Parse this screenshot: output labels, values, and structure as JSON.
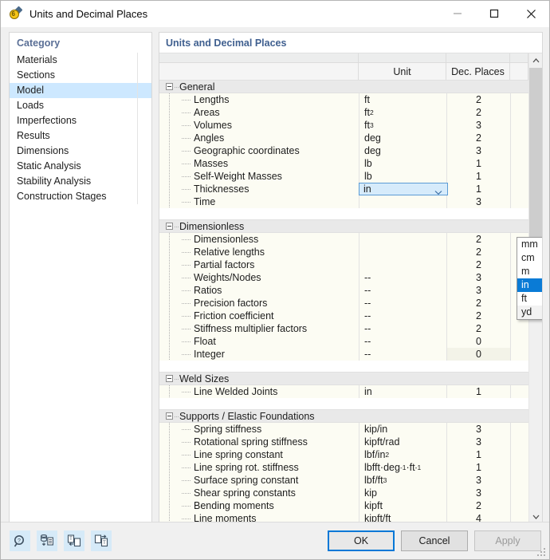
{
  "window": {
    "title": "Units and Decimal Places",
    "icon": "units-dialog-icon",
    "minimize_label": "Minimize",
    "maximize_label": "Maximize",
    "close_label": "Close"
  },
  "category": {
    "header": "Category",
    "items": [
      {
        "label": "Materials",
        "selected": false
      },
      {
        "label": "Sections",
        "selected": false
      },
      {
        "label": "Model",
        "selected": true
      },
      {
        "label": "Loads",
        "selected": false
      },
      {
        "label": "Imperfections",
        "selected": false
      },
      {
        "label": "Results",
        "selected": false
      },
      {
        "label": "Dimensions",
        "selected": false
      },
      {
        "label": "Static Analysis",
        "selected": false
      },
      {
        "label": "Stability Analysis",
        "selected": false
      },
      {
        "label": "Construction Stages",
        "selected": false
      }
    ]
  },
  "panel": {
    "title": "Units and Decimal Places",
    "columns": [
      "",
      "Unit",
      "Dec. Places",
      ""
    ],
    "groups": [
      {
        "name": "General",
        "rows": [
          {
            "label": "Lengths",
            "unit": "ft",
            "unit_sup": "",
            "dec": "2"
          },
          {
            "label": "Areas",
            "unit": "ft",
            "unit_sup": "2",
            "dec": "2"
          },
          {
            "label": "Volumes",
            "unit": "ft",
            "unit_sup": "3",
            "dec": "3"
          },
          {
            "label": "Angles",
            "unit": "deg",
            "unit_sup": "",
            "dec": "2"
          },
          {
            "label": "Geographic coordinates",
            "unit": "deg",
            "unit_sup": "",
            "dec": "3"
          },
          {
            "label": "Masses",
            "unit": "lb",
            "unit_sup": "",
            "dec": "1"
          },
          {
            "label": "Self-Weight Masses",
            "unit": "lb",
            "unit_sup": "",
            "dec": "1"
          },
          {
            "label": "Thicknesses",
            "unit": "in",
            "unit_sup": "",
            "dec": "1",
            "editing": true
          },
          {
            "label": "Time",
            "unit": "",
            "unit_sup": "",
            "dec": "3"
          }
        ]
      },
      {
        "name": "Dimensionless",
        "rows": [
          {
            "label": "Dimensionless",
            "unit": "",
            "unit_sup": "",
            "dec": "2"
          },
          {
            "label": "Relative lengths",
            "unit": "",
            "unit_sup": "",
            "dec": "2"
          },
          {
            "label": "Partial factors",
            "unit": "",
            "unit_sup": "",
            "dec": "2"
          },
          {
            "label": "Weights/Nodes",
            "unit": "--",
            "unit_sup": "",
            "dec": "3"
          },
          {
            "label": "Ratios",
            "unit": "--",
            "unit_sup": "",
            "dec": "3"
          },
          {
            "label": "Precision factors",
            "unit": "--",
            "unit_sup": "",
            "dec": "2"
          },
          {
            "label": "Friction coefficient",
            "unit": "--",
            "unit_sup": "",
            "dec": "2"
          },
          {
            "label": "Stiffness multiplier factors",
            "unit": "--",
            "unit_sup": "",
            "dec": "2"
          },
          {
            "label": "Float",
            "unit": "--",
            "unit_sup": "",
            "dec": "0"
          },
          {
            "label": "Integer",
            "unit": "--",
            "unit_sup": "",
            "dec": "0",
            "dec_highlight": true
          }
        ]
      },
      {
        "name": "Weld Sizes",
        "rows": [
          {
            "label": "Line Welded Joints",
            "unit": "in",
            "unit_sup": "",
            "dec": "1"
          }
        ]
      },
      {
        "name": "Supports / Elastic Foundations",
        "rows": [
          {
            "label": "Spring stiffness",
            "unit": "kip/in",
            "unit_sup": "",
            "dec": "3"
          },
          {
            "label": "Rotational spring stiffness",
            "unit": "kipft/rad",
            "unit_sup": "",
            "dec": "3"
          },
          {
            "label": "Line spring constant",
            "unit": "lbf/in",
            "unit_sup": "2",
            "dec": "1"
          },
          {
            "label": "Line spring rot. stiffness",
            "unit": "lbfft·deg",
            "unit_sup": "-1",
            "unit_tail": "·ft",
            "unit_tail_sup": "-1",
            "dec": "1"
          },
          {
            "label": "Surface spring constant",
            "unit": "lbf/ft",
            "unit_sup": "3",
            "dec": "3"
          },
          {
            "label": "Shear spring constants",
            "unit": "kip",
            "unit_sup": "",
            "dec": "3"
          },
          {
            "label": "Bending moments",
            "unit": "kipft",
            "unit_sup": "",
            "dec": "2"
          },
          {
            "label": "Line moments",
            "unit": "kipft/ft",
            "unit_sup": "",
            "dec": "4"
          }
        ]
      }
    ]
  },
  "dropdown": {
    "open": true,
    "options": [
      "mm",
      "cm",
      "m",
      "in",
      "ft",
      "yd"
    ],
    "selected": "in"
  },
  "footer": {
    "tools": [
      {
        "name": "find-icon",
        "label": "Find"
      },
      {
        "name": "import-database-icon",
        "label": "Import from database"
      },
      {
        "name": "import-units-icon",
        "label": "Import units"
      },
      {
        "name": "export-units-icon",
        "label": "Export units"
      }
    ],
    "buttons": [
      {
        "label": "OK",
        "state": "default"
      },
      {
        "label": "Cancel",
        "state": "normal"
      },
      {
        "label": "Apply",
        "state": "disabled"
      }
    ]
  },
  "colors": {
    "selection_blue": "#0a7bd6",
    "accent_border": "#0078d7",
    "row_cream": "#fcfcf3",
    "group_gray": "#e9e9e9",
    "cat_selected": "#cde8ff"
  }
}
